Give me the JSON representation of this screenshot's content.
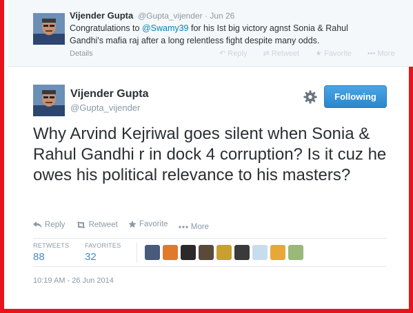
{
  "previous_tweet": {
    "name": "Vijender Gupta",
    "handle": "@Gupta_vijender",
    "separator": "·",
    "date": "Jun 26",
    "text_before": "Congratulations to ",
    "mention": "@Swamy39",
    "text_after": " for his Ist big victory agnst Sonia & Rahul Gandhi's mafia raj after a long relentless fight despite many odds.",
    "details_label": "Details",
    "actions": [
      "Reply",
      "Retweet",
      "Favorite",
      "More"
    ]
  },
  "main_tweet": {
    "name": "Vijender Gupta",
    "handle": "@Gupta_vijender",
    "follow_label": "Following",
    "text": "Why Arvind Kejriwal goes silent when Sonia & Rahul Gandhi r in dock 4 corruption? Is it cuz he owes his political relevance to his masters?",
    "actions": {
      "reply": "Reply",
      "retweet": "Retweet",
      "favorite": "Favorite",
      "more": "More"
    },
    "stats": {
      "retweets_label": "RETWEETS",
      "retweets_count": "88",
      "favorites_label": "FAVORITES",
      "favorites_count": "32"
    },
    "favoriter_avatars": [
      {
        "color": "#4a5a7a"
      },
      {
        "color": "#e07a2a"
      },
      {
        "color": "#2a2a2a"
      },
      {
        "color": "#5a4a3a"
      },
      {
        "color": "#c8a030"
      },
      {
        "color": "#3a3a3a"
      },
      {
        "color": "#c8dcef"
      },
      {
        "color": "#e8a838"
      },
      {
        "color": "#9ab87a"
      }
    ],
    "timestamp": "10:19 AM - 26 Jun 2014"
  },
  "colors": {
    "border": "#e8141b",
    "link": "#0084b4",
    "button": "#2b87cc",
    "muted": "#8899a6"
  }
}
